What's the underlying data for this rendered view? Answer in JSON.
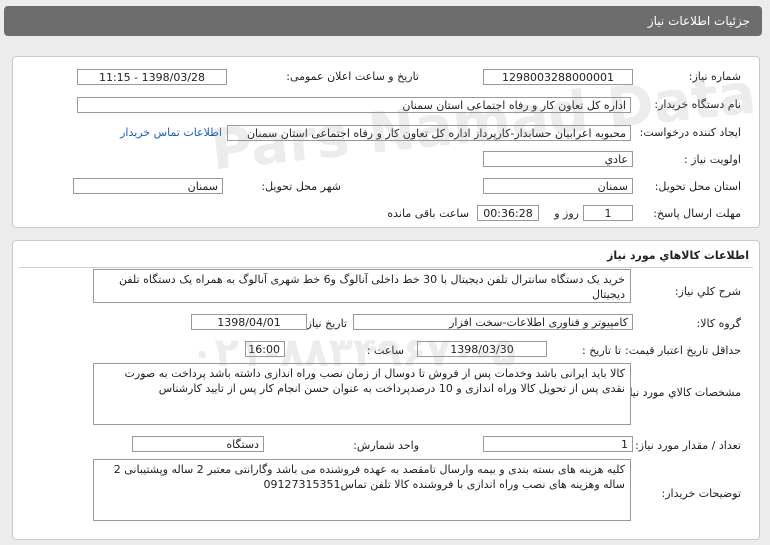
{
  "title": "جزئیات اطلاعات نیاز",
  "need_number": {
    "label": "شماره نیاز:",
    "value": "1298003288000001"
  },
  "announce": {
    "label": "تاریخ و ساعت اعلان عمومی:",
    "value": "1398/03/28 - 11:15"
  },
  "buyer": {
    "label": "نام دستگاه خریدار:",
    "value": "اداره کل تعاون کار و رفاه اجتماعی استان سمنان"
  },
  "creator": {
    "label": "ایجاد کننده درخواست:",
    "value": "محبوبه اعرابیان حسابدار-کارپرداز اداره کل تعاون کار و رفاه اجتماعی استان سمنان",
    "contact_link": "اطلاعات تماس خریدار"
  },
  "priority": {
    "label": "اولویت نیاز :",
    "value": "عادي"
  },
  "province": {
    "label": "استان محل تحویل:",
    "value": "سمنان"
  },
  "city": {
    "label": "شهر محل تحویل:",
    "value": "سمنان"
  },
  "deadline": {
    "label": "مهلت ارسال پاسخ:",
    "days": "1",
    "days_label": "روز و",
    "time": "00:36:28",
    "remaining_label": "ساعت باقی مانده"
  },
  "goods_section_title": "اطلاعات کالاهاي مورد نياز",
  "general_desc": {
    "label": "شرح کلي نياز:",
    "value": "خرید یک دستگاه سانترال  تلفن دیجیتال با 30 خط داخلی آنالوگ و6 خط شهری آنالوگ به همراه یک دستگاه تلفن دیجیتال"
  },
  "goods_group": {
    "label": "گروه کالا:",
    "value": "کامپیوتر و فناوری اطلاعات-سخت افزار",
    "need_date_label": "تاریخ نیاز به کالا:",
    "need_date": "1398/04/01"
  },
  "price_validity": {
    "label": "حداقل تاريخ اعتبار قيمت:",
    "to_label": "تا تاریخ :",
    "date": "1398/03/30",
    "time_label": "ساعت :",
    "time": "16:00"
  },
  "specs": {
    "label": "مشخصات کالاي مورد نياز:",
    "value": "کالا باید ایرانی باشد وخدمات پس از فروش تا دوسال از زمان نصب وراه اندازی داشته باشد پرداخت به صورت نقدی پس از تحویل کالا وراه اندازی و 10 درصدپرداخت به عنوان حسن انجام کار پس از تایید کارشناس"
  },
  "quantity": {
    "label": "تعداد / مقدار مورد نیاز:",
    "value": "1",
    "unit_label": "واحد شمارش:",
    "unit": "دستگاه"
  },
  "buyer_notes": {
    "label": "توضیحات خریدار:",
    "value": "کلیه هزینه های بسته بندی و بیمه وارسال تامقصد به عهده فروشنده می باشد وگارانتی معتبر 2 ساله  وپشتیبانی 2 ساله وهزینه های نصب وراه اندازی با فروشنده کالا تلفن تماس09127315351"
  },
  "watermark": {
    "line1": "Pars Namad Data",
    "line2": "۰۲۱-۸۸۳۴۹۶۷۰-۵"
  }
}
